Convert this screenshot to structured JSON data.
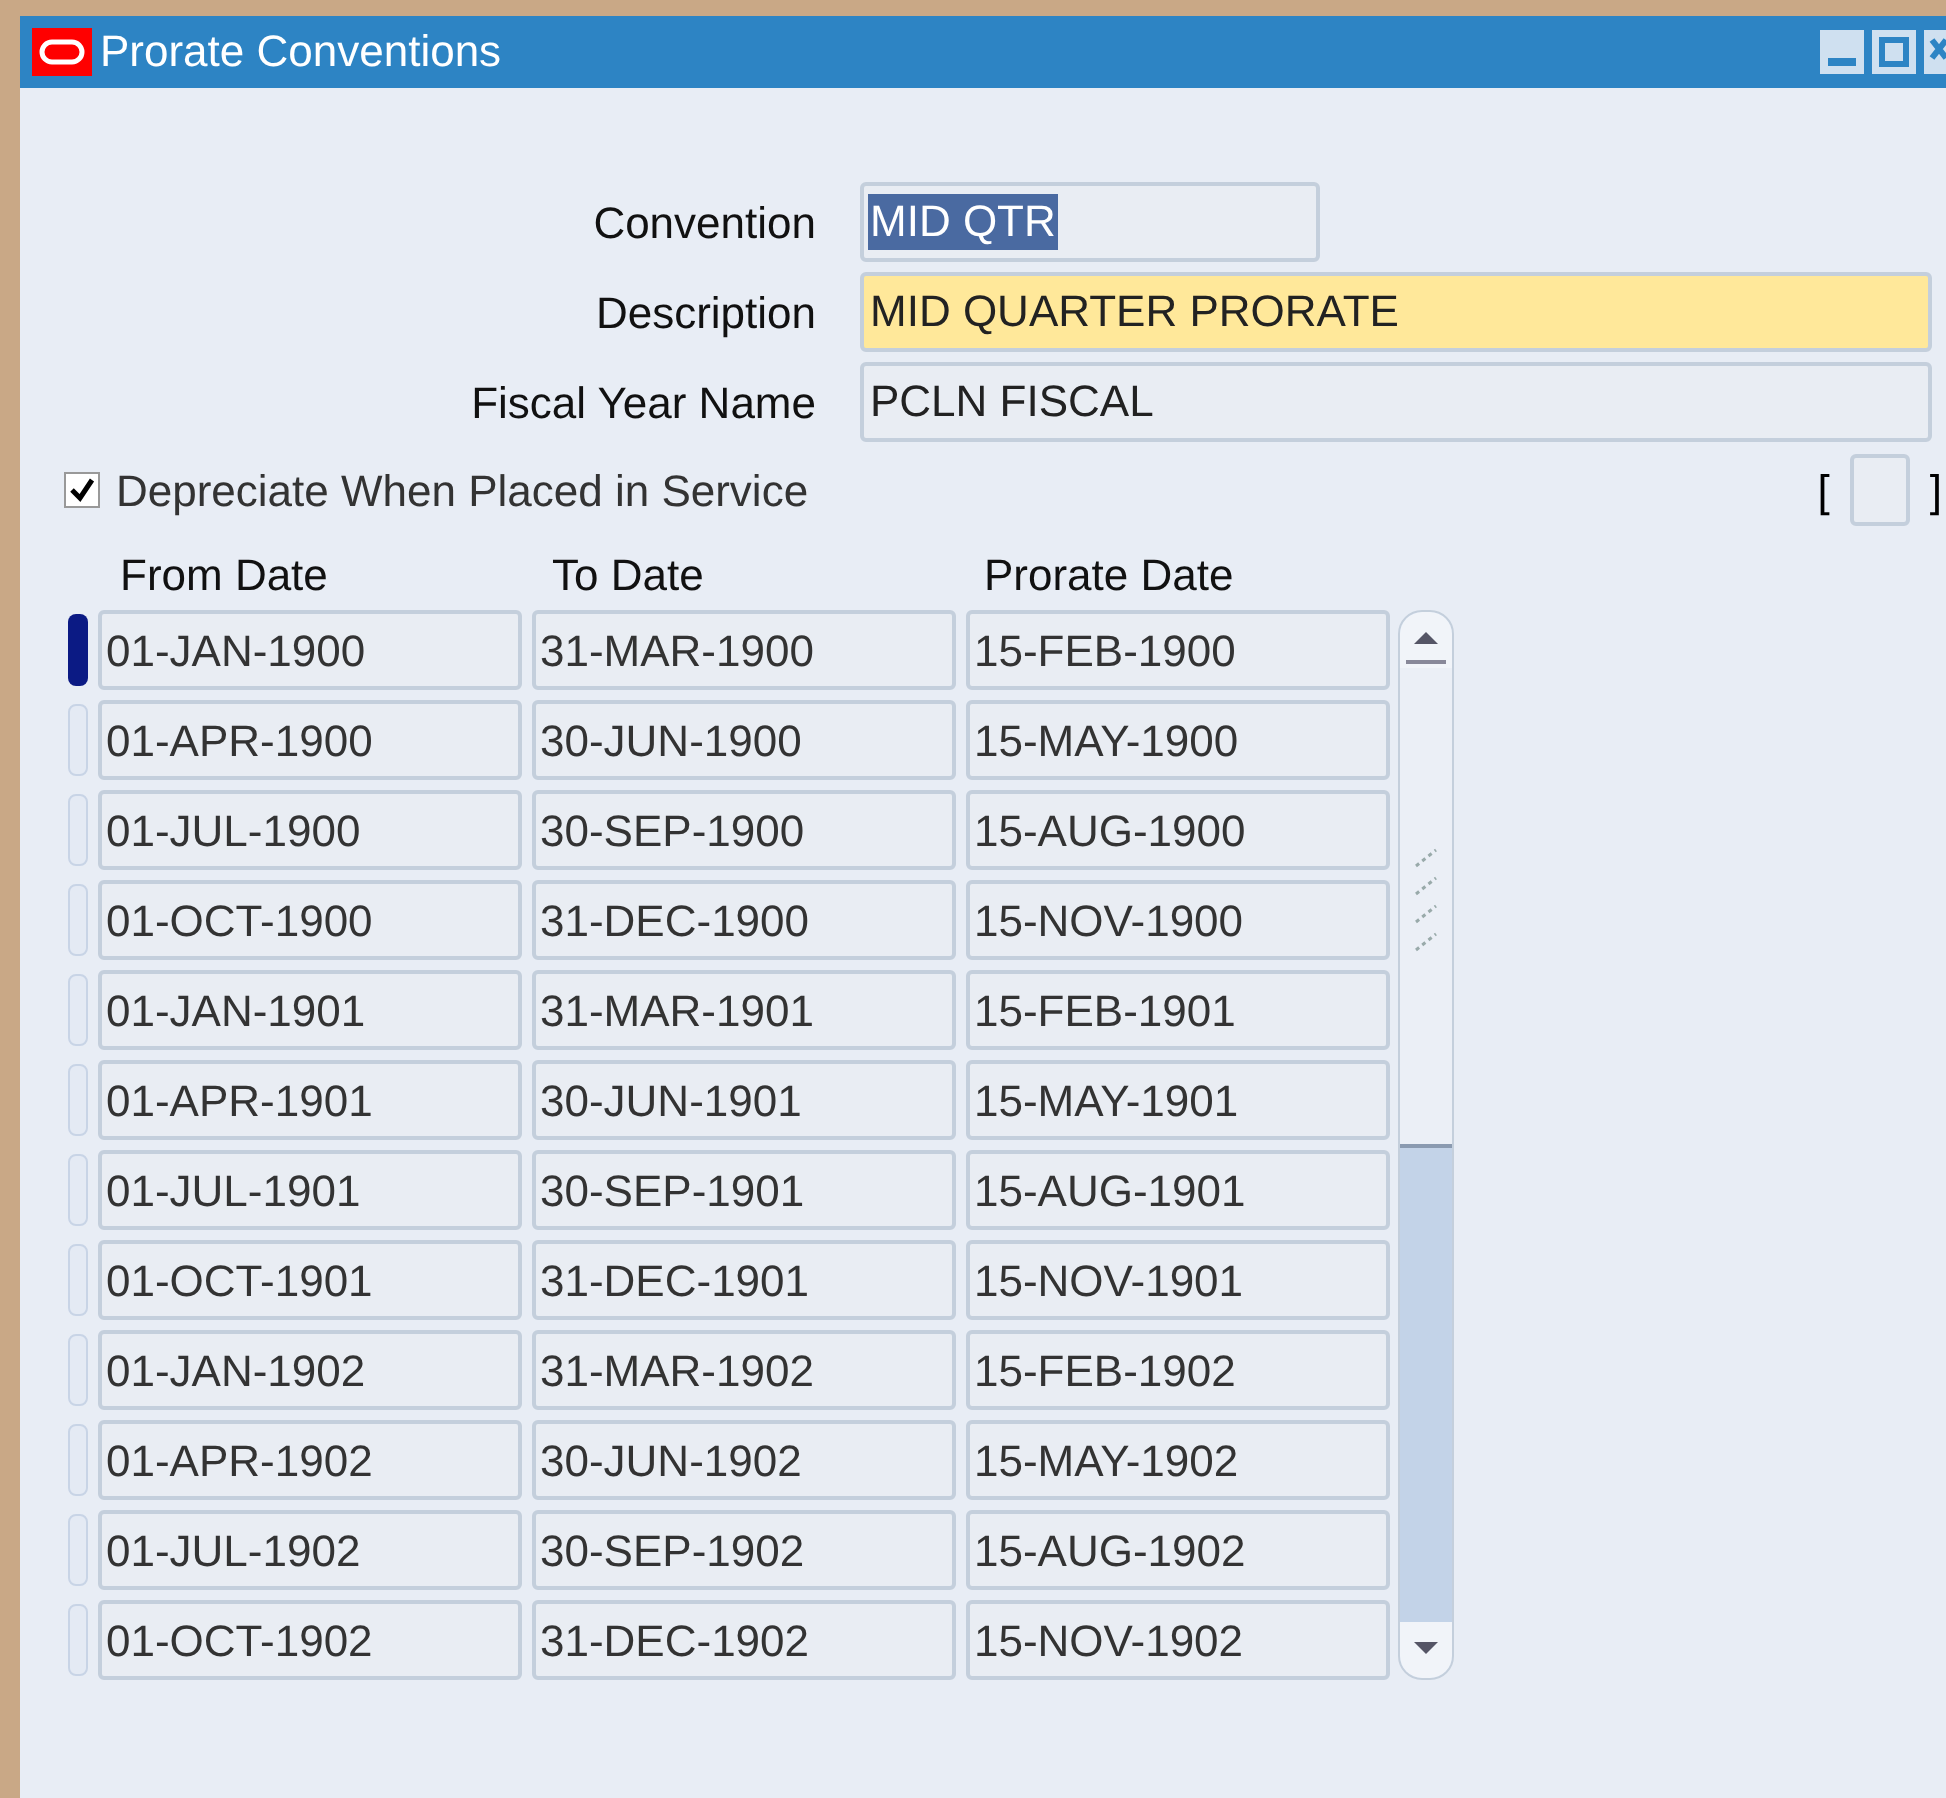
{
  "window": {
    "title": "Prorate Conventions"
  },
  "fields": [
    {
      "label": "Convention",
      "value": "MID QTR",
      "focused": false,
      "text_selected": true,
      "kind": "short"
    },
    {
      "label": "Description",
      "value": "MID QUARTER PRORATE",
      "focused": true,
      "text_selected": false,
      "kind": "long"
    },
    {
      "label": "Fiscal Year Name",
      "value": "PCLN FISCAL",
      "focused": false,
      "text_selected": false,
      "kind": "long"
    }
  ],
  "depreciate_checkbox": {
    "label": "Depreciate When Placed in Service",
    "checked": true
  },
  "context_field": {
    "open_bracket": "[",
    "close_bracket": "]"
  },
  "table": {
    "columns": [
      "From Date",
      "To Date",
      "Prorate Date"
    ],
    "rows": [
      {
        "selected": true,
        "cells": [
          "01-JAN-1900",
          "31-MAR-1900",
          "15-FEB-1900"
        ]
      },
      {
        "selected": false,
        "cells": [
          "01-APR-1900",
          "30-JUN-1900",
          "15-MAY-1900"
        ]
      },
      {
        "selected": false,
        "cells": [
          "01-JUL-1900",
          "30-SEP-1900",
          "15-AUG-1900"
        ]
      },
      {
        "selected": false,
        "cells": [
          "01-OCT-1900",
          "31-DEC-1900",
          "15-NOV-1900"
        ]
      },
      {
        "selected": false,
        "cells": [
          "01-JAN-1901",
          "31-MAR-1901",
          "15-FEB-1901"
        ]
      },
      {
        "selected": false,
        "cells": [
          "01-APR-1901",
          "30-JUN-1901",
          "15-MAY-1901"
        ]
      },
      {
        "selected": false,
        "cells": [
          "01-JUL-1901",
          "30-SEP-1901",
          "15-AUG-1901"
        ]
      },
      {
        "selected": false,
        "cells": [
          "01-OCT-1901",
          "31-DEC-1901",
          "15-NOV-1901"
        ]
      },
      {
        "selected": false,
        "cells": [
          "01-JAN-1902",
          "31-MAR-1902",
          "15-FEB-1902"
        ]
      },
      {
        "selected": false,
        "cells": [
          "01-APR-1902",
          "30-JUN-1902",
          "15-MAY-1902"
        ]
      },
      {
        "selected": false,
        "cells": [
          "01-JUL-1902",
          "30-SEP-1902",
          "15-AUG-1902"
        ]
      },
      {
        "selected": false,
        "cells": [
          "01-OCT-1902",
          "31-DEC-1902",
          "15-NOV-1902"
        ]
      }
    ]
  }
}
